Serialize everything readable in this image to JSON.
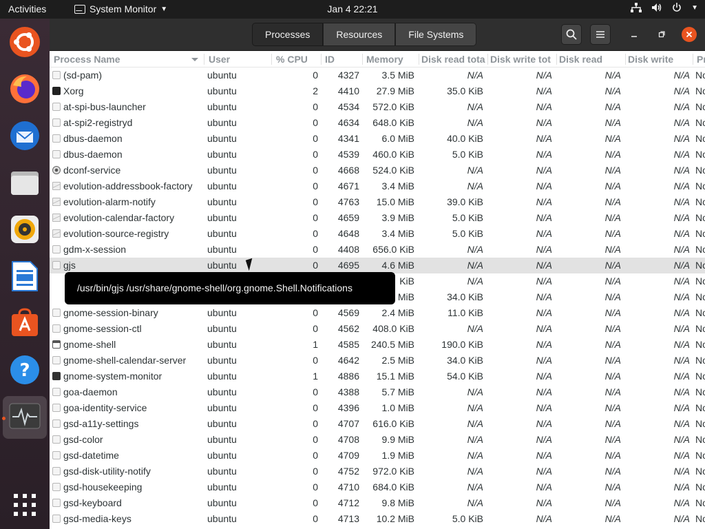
{
  "topbar": {
    "activities": "Activities",
    "app_name": "System Monitor",
    "clock": "Jan 4  22:21"
  },
  "dock": {
    "apps": [
      "ubuntu-logo-icon",
      "firefox-icon",
      "thunderbird-icon",
      "files-icon",
      "rhythmbox-icon",
      "libreoffice-writer-icon",
      "ubuntu-software-icon",
      "help-icon",
      "system-monitor-icon",
      "show-apps-icon"
    ]
  },
  "header": {
    "tabs": [
      "Processes",
      "Resources",
      "File Systems"
    ],
    "active_tab": "Processes"
  },
  "columns": [
    "Process Name",
    "User",
    "% CPU",
    "ID",
    "Memory",
    "Disk read tota",
    "Disk write tot",
    "Disk read",
    "Disk write",
    "Pr"
  ],
  "rows": [
    {
      "name": "(sd-pam)",
      "user": "ubuntu",
      "cpu": "0",
      "id": "4327",
      "mem": "3.5 MiB",
      "drt": "N/A",
      "dwt": "N/A",
      "dr": "N/A",
      "dw": "N/A",
      "pr": "No",
      "icon": "process-icon"
    },
    {
      "name": "Xorg",
      "user": "ubuntu",
      "cpu": "2",
      "id": "4410",
      "mem": "27.9 MiB",
      "drt": "35.0 KiB",
      "dwt": "N/A",
      "dr": "N/A",
      "dw": "N/A",
      "pr": "No",
      "icon": "display-icon"
    },
    {
      "name": "at-spi-bus-launcher",
      "user": "ubuntu",
      "cpu": "0",
      "id": "4534",
      "mem": "572.0 KiB",
      "drt": "N/A",
      "dwt": "N/A",
      "dr": "N/A",
      "dw": "N/A",
      "pr": "No",
      "icon": "process-icon"
    },
    {
      "name": "at-spi2-registryd",
      "user": "ubuntu",
      "cpu": "0",
      "id": "4634",
      "mem": "648.0 KiB",
      "drt": "N/A",
      "dwt": "N/A",
      "dr": "N/A",
      "dw": "N/A",
      "pr": "No",
      "icon": "process-icon"
    },
    {
      "name": "dbus-daemon",
      "user": "ubuntu",
      "cpu": "0",
      "id": "4341",
      "mem": "6.0 MiB",
      "drt": "40.0 KiB",
      "dwt": "N/A",
      "dr": "N/A",
      "dw": "N/A",
      "pr": "No",
      "icon": "process-icon"
    },
    {
      "name": "dbus-daemon",
      "user": "ubuntu",
      "cpu": "0",
      "id": "4539",
      "mem": "460.0 KiB",
      "drt": "5.0 KiB",
      "dwt": "N/A",
      "dr": "N/A",
      "dw": "N/A",
      "pr": "No",
      "icon": "process-icon"
    },
    {
      "name": "dconf-service",
      "user": "ubuntu",
      "cpu": "0",
      "id": "4668",
      "mem": "524.0 KiB",
      "drt": "N/A",
      "dwt": "N/A",
      "dr": "N/A",
      "dw": "N/A",
      "pr": "No",
      "icon": "gear-icon"
    },
    {
      "name": "evolution-addressbook-factory",
      "user": "ubuntu",
      "cpu": "0",
      "id": "4671",
      "mem": "3.4 MiB",
      "drt": "N/A",
      "dwt": "N/A",
      "dr": "N/A",
      "dw": "N/A",
      "pr": "No",
      "icon": "envelope-icon"
    },
    {
      "name": "evolution-alarm-notify",
      "user": "ubuntu",
      "cpu": "0",
      "id": "4763",
      "mem": "15.0 MiB",
      "drt": "39.0 KiB",
      "dwt": "N/A",
      "dr": "N/A",
      "dw": "N/A",
      "pr": "No",
      "icon": "envelope-icon"
    },
    {
      "name": "evolution-calendar-factory",
      "user": "ubuntu",
      "cpu": "0",
      "id": "4659",
      "mem": "3.9 MiB",
      "drt": "5.0 KiB",
      "dwt": "N/A",
      "dr": "N/A",
      "dw": "N/A",
      "pr": "No",
      "icon": "envelope-icon"
    },
    {
      "name": "evolution-source-registry",
      "user": "ubuntu",
      "cpu": "0",
      "id": "4648",
      "mem": "3.4 MiB",
      "drt": "5.0 KiB",
      "dwt": "N/A",
      "dr": "N/A",
      "dw": "N/A",
      "pr": "No",
      "icon": "envelope-icon"
    },
    {
      "name": "gdm-x-session",
      "user": "ubuntu",
      "cpu": "0",
      "id": "4408",
      "mem": "656.0 KiB",
      "drt": "N/A",
      "dwt": "N/A",
      "dr": "N/A",
      "dw": "N/A",
      "pr": "No",
      "icon": "process-icon"
    },
    {
      "name": "gjs",
      "user": "ubuntu",
      "cpu": "0",
      "id": "4695",
      "mem": "4.6 MiB",
      "drt": "N/A",
      "dwt": "N/A",
      "dr": "N/A",
      "dw": "N/A",
      "pr": "No",
      "icon": "process-icon"
    },
    {
      "name": "",
      "user": "",
      "cpu": "",
      "id": "",
      "mem": "KiB",
      "drt": "N/A",
      "dwt": "N/A",
      "dr": "N/A",
      "dw": "N/A",
      "pr": "No",
      "icon": "process-icon"
    },
    {
      "name": "",
      "user": "",
      "cpu": "",
      "id": "",
      "mem": "MiB",
      "drt": "34.0 KiB",
      "dwt": "N/A",
      "dr": "N/A",
      "dw": "N/A",
      "pr": "No",
      "icon": "process-icon"
    },
    {
      "name": "gnome-session-binary",
      "user": "ubuntu",
      "cpu": "0",
      "id": "4569",
      "mem": "2.4 MiB",
      "drt": "11.0 KiB",
      "dwt": "N/A",
      "dr": "N/A",
      "dw": "N/A",
      "pr": "No",
      "icon": "process-icon"
    },
    {
      "name": "gnome-session-ctl",
      "user": "ubuntu",
      "cpu": "0",
      "id": "4562",
      "mem": "408.0 KiB",
      "drt": "N/A",
      "dwt": "N/A",
      "dr": "N/A",
      "dw": "N/A",
      "pr": "No",
      "icon": "process-icon"
    },
    {
      "name": "gnome-shell",
      "user": "ubuntu",
      "cpu": "1",
      "id": "4585",
      "mem": "240.5 MiB",
      "drt": "190.0 KiB",
      "dwt": "N/A",
      "dr": "N/A",
      "dw": "N/A",
      "pr": "No",
      "icon": "window-icon"
    },
    {
      "name": "gnome-shell-calendar-server",
      "user": "ubuntu",
      "cpu": "0",
      "id": "4642",
      "mem": "2.5 MiB",
      "drt": "34.0 KiB",
      "dwt": "N/A",
      "dr": "N/A",
      "dw": "N/A",
      "pr": "No",
      "icon": "process-icon"
    },
    {
      "name": "gnome-system-monitor",
      "user": "ubuntu",
      "cpu": "1",
      "id": "4886",
      "mem": "15.1 MiB",
      "drt": "54.0 KiB",
      "dwt": "N/A",
      "dr": "N/A",
      "dw": "N/A",
      "pr": "No",
      "icon": "monitor-icon"
    },
    {
      "name": "goa-daemon",
      "user": "ubuntu",
      "cpu": "0",
      "id": "4388",
      "mem": "5.7 MiB",
      "drt": "N/A",
      "dwt": "N/A",
      "dr": "N/A",
      "dw": "N/A",
      "pr": "No",
      "icon": "process-icon"
    },
    {
      "name": "goa-identity-service",
      "user": "ubuntu",
      "cpu": "0",
      "id": "4396",
      "mem": "1.0 MiB",
      "drt": "N/A",
      "dwt": "N/A",
      "dr": "N/A",
      "dw": "N/A",
      "pr": "No",
      "icon": "process-icon"
    },
    {
      "name": "gsd-a11y-settings",
      "user": "ubuntu",
      "cpu": "0",
      "id": "4707",
      "mem": "616.0 KiB",
      "drt": "N/A",
      "dwt": "N/A",
      "dr": "N/A",
      "dw": "N/A",
      "pr": "No",
      "icon": "process-icon"
    },
    {
      "name": "gsd-color",
      "user": "ubuntu",
      "cpu": "0",
      "id": "4708",
      "mem": "9.9 MiB",
      "drt": "N/A",
      "dwt": "N/A",
      "dr": "N/A",
      "dw": "N/A",
      "pr": "No",
      "icon": "process-icon"
    },
    {
      "name": "gsd-datetime",
      "user": "ubuntu",
      "cpu": "0",
      "id": "4709",
      "mem": "1.9 MiB",
      "drt": "N/A",
      "dwt": "N/A",
      "dr": "N/A",
      "dw": "N/A",
      "pr": "No",
      "icon": "process-icon"
    },
    {
      "name": "gsd-disk-utility-notify",
      "user": "ubuntu",
      "cpu": "0",
      "id": "4752",
      "mem": "972.0 KiB",
      "drt": "N/A",
      "dwt": "N/A",
      "dr": "N/A",
      "dw": "N/A",
      "pr": "No",
      "icon": "process-icon"
    },
    {
      "name": "gsd-housekeeping",
      "user": "ubuntu",
      "cpu": "0",
      "id": "4710",
      "mem": "684.0 KiB",
      "drt": "N/A",
      "dwt": "N/A",
      "dr": "N/A",
      "dw": "N/A",
      "pr": "No",
      "icon": "process-icon"
    },
    {
      "name": "gsd-keyboard",
      "user": "ubuntu",
      "cpu": "0",
      "id": "4712",
      "mem": "9.8 MiB",
      "drt": "N/A",
      "dwt": "N/A",
      "dr": "N/A",
      "dw": "N/A",
      "pr": "No",
      "icon": "process-icon"
    },
    {
      "name": "gsd-media-keys",
      "user": "ubuntu",
      "cpu": "0",
      "id": "4713",
      "mem": "10.2 MiB",
      "drt": "5.0 KiB",
      "dwt": "N/A",
      "dr": "N/A",
      "dw": "N/A",
      "pr": "No",
      "icon": "process-icon"
    }
  ],
  "hover_row_index": 12,
  "tooltip": "/usr/bin/gjs /usr/share/gnome-shell/org.gnome.Shell.Notifications"
}
